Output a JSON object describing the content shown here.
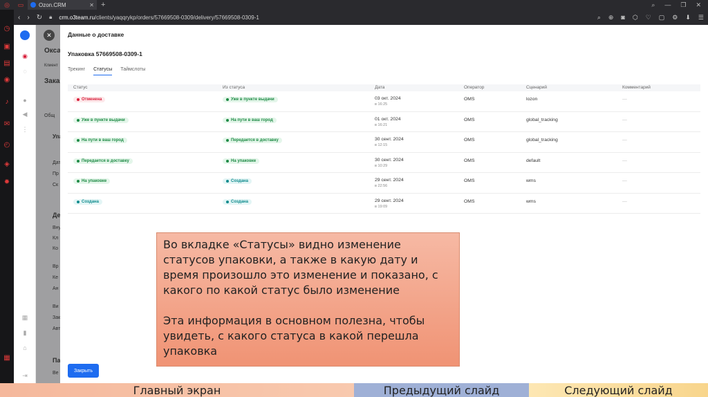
{
  "browser": {
    "tab_title": "Ozon.CRM",
    "url_host": "crm.o3team.ru",
    "url_path": "/clients/yaqqrykp/orders/57669508-0309/delivery/57669508-0309-1"
  },
  "background": {
    "texts": [
      "Окса",
      "Клиент",
      "Зака",
      "Общ",
      "Упа",
      "Дат",
      "Пр",
      "Ск",
      "Де",
      "Вну",
      "Кл",
      "Ко",
      "Вр",
      "Ке",
      "Ан",
      "Ви",
      "Зак",
      "Авт",
      "Па",
      "Ве"
    ]
  },
  "drawer": {
    "title": "Данные о доставке",
    "package_title": "Упаковка 57669508-0309-1",
    "tabs": [
      {
        "label": "Трекинг",
        "active": false
      },
      {
        "label": "Статусы",
        "active": true
      },
      {
        "label": "Таймслоты",
        "active": false
      }
    ],
    "columns": [
      "Статус",
      "Из статуса",
      "Дата",
      "Оператор",
      "Сценарий",
      "Комментарий"
    ],
    "rows": [
      {
        "status": "Отменена",
        "status_color": "red",
        "from": "Уже в пункте выдачи",
        "from_color": "green",
        "date": "03 окт. 2024",
        "time": "в 16:25",
        "operator": "OMS",
        "scenario": "lozon",
        "comment": "—"
      },
      {
        "status": "Уже в пункте выдачи",
        "status_color": "green",
        "from": "На пути в ваш город",
        "from_color": "green",
        "date": "01 окт. 2024",
        "time": "в 16:21",
        "operator": "OMS",
        "scenario": "global_tracking",
        "comment": "—"
      },
      {
        "status": "На пути в ваш город",
        "status_color": "green",
        "from": "Передается в доставку",
        "from_color": "green",
        "date": "30 сент. 2024",
        "time": "в 12:15",
        "operator": "OMS",
        "scenario": "global_tracking",
        "comment": "—"
      },
      {
        "status": "Передается в доставку",
        "status_color": "green",
        "from": "На упаковке",
        "from_color": "green",
        "date": "30 сент. 2024",
        "time": "в 10:29",
        "operator": "OMS",
        "scenario": "default",
        "comment": "—"
      },
      {
        "status": "На упаковке",
        "status_color": "green",
        "from": "Создана",
        "from_color": "teal",
        "date": "29 сент. 2024",
        "time": "в 22:56",
        "operator": "OMS",
        "scenario": "wms",
        "comment": "—"
      },
      {
        "status": "Создана",
        "status_color": "teal",
        "from": "Создана",
        "from_color": "teal",
        "date": "29 сент. 2024",
        "time": "в 19:09",
        "operator": "OMS",
        "scenario": "wms",
        "comment": "—"
      }
    ],
    "close_button": "Закрыть"
  },
  "note": {
    "paragraph1": "Во вкладке «Статусы» видно изменение статусов упаковки, а также в какую дату и время произошло это изменение и показано, с какого по какой статус было изменение",
    "paragraph2": "Эта информация в основном полезна, чтобы увидеть, с какого статуса в какой перешла упаковка"
  },
  "slide_nav": {
    "home": "Главный экран",
    "prev": "Предыдущий слайд",
    "next": "Следующий слайд"
  },
  "colors": {
    "accent": "#1e6cf0",
    "status_red": "#d81e3a",
    "status_green": "#1e8a45",
    "status_teal": "#0f8b8d",
    "note_bg": "#f09374"
  }
}
